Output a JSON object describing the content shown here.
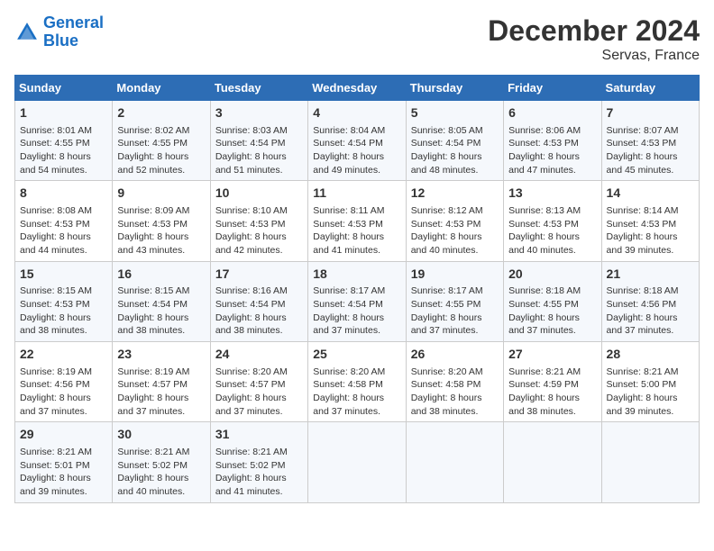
{
  "logo": {
    "line1": "General",
    "line2": "Blue"
  },
  "title": "December 2024",
  "subtitle": "Servas, France",
  "days_of_week": [
    "Sunday",
    "Monday",
    "Tuesday",
    "Wednesday",
    "Thursday",
    "Friday",
    "Saturday"
  ],
  "weeks": [
    [
      {
        "day": "1",
        "sunrise": "Sunrise: 8:01 AM",
        "sunset": "Sunset: 4:55 PM",
        "daylight": "Daylight: 8 hours and 54 minutes."
      },
      {
        "day": "2",
        "sunrise": "Sunrise: 8:02 AM",
        "sunset": "Sunset: 4:55 PM",
        "daylight": "Daylight: 8 hours and 52 minutes."
      },
      {
        "day": "3",
        "sunrise": "Sunrise: 8:03 AM",
        "sunset": "Sunset: 4:54 PM",
        "daylight": "Daylight: 8 hours and 51 minutes."
      },
      {
        "day": "4",
        "sunrise": "Sunrise: 8:04 AM",
        "sunset": "Sunset: 4:54 PM",
        "daylight": "Daylight: 8 hours and 49 minutes."
      },
      {
        "day": "5",
        "sunrise": "Sunrise: 8:05 AM",
        "sunset": "Sunset: 4:54 PM",
        "daylight": "Daylight: 8 hours and 48 minutes."
      },
      {
        "day": "6",
        "sunrise": "Sunrise: 8:06 AM",
        "sunset": "Sunset: 4:53 PM",
        "daylight": "Daylight: 8 hours and 47 minutes."
      },
      {
        "day": "7",
        "sunrise": "Sunrise: 8:07 AM",
        "sunset": "Sunset: 4:53 PM",
        "daylight": "Daylight: 8 hours and 45 minutes."
      }
    ],
    [
      {
        "day": "8",
        "sunrise": "Sunrise: 8:08 AM",
        "sunset": "Sunset: 4:53 PM",
        "daylight": "Daylight: 8 hours and 44 minutes."
      },
      {
        "day": "9",
        "sunrise": "Sunrise: 8:09 AM",
        "sunset": "Sunset: 4:53 PM",
        "daylight": "Daylight: 8 hours and 43 minutes."
      },
      {
        "day": "10",
        "sunrise": "Sunrise: 8:10 AM",
        "sunset": "Sunset: 4:53 PM",
        "daylight": "Daylight: 8 hours and 42 minutes."
      },
      {
        "day": "11",
        "sunrise": "Sunrise: 8:11 AM",
        "sunset": "Sunset: 4:53 PM",
        "daylight": "Daylight: 8 hours and 41 minutes."
      },
      {
        "day": "12",
        "sunrise": "Sunrise: 8:12 AM",
        "sunset": "Sunset: 4:53 PM",
        "daylight": "Daylight: 8 hours and 40 minutes."
      },
      {
        "day": "13",
        "sunrise": "Sunrise: 8:13 AM",
        "sunset": "Sunset: 4:53 PM",
        "daylight": "Daylight: 8 hours and 40 minutes."
      },
      {
        "day": "14",
        "sunrise": "Sunrise: 8:14 AM",
        "sunset": "Sunset: 4:53 PM",
        "daylight": "Daylight: 8 hours and 39 minutes."
      }
    ],
    [
      {
        "day": "15",
        "sunrise": "Sunrise: 8:15 AM",
        "sunset": "Sunset: 4:53 PM",
        "daylight": "Daylight: 8 hours and 38 minutes."
      },
      {
        "day": "16",
        "sunrise": "Sunrise: 8:15 AM",
        "sunset": "Sunset: 4:54 PM",
        "daylight": "Daylight: 8 hours and 38 minutes."
      },
      {
        "day": "17",
        "sunrise": "Sunrise: 8:16 AM",
        "sunset": "Sunset: 4:54 PM",
        "daylight": "Daylight: 8 hours and 38 minutes."
      },
      {
        "day": "18",
        "sunrise": "Sunrise: 8:17 AM",
        "sunset": "Sunset: 4:54 PM",
        "daylight": "Daylight: 8 hours and 37 minutes."
      },
      {
        "day": "19",
        "sunrise": "Sunrise: 8:17 AM",
        "sunset": "Sunset: 4:55 PM",
        "daylight": "Daylight: 8 hours and 37 minutes."
      },
      {
        "day": "20",
        "sunrise": "Sunrise: 8:18 AM",
        "sunset": "Sunset: 4:55 PM",
        "daylight": "Daylight: 8 hours and 37 minutes."
      },
      {
        "day": "21",
        "sunrise": "Sunrise: 8:18 AM",
        "sunset": "Sunset: 4:56 PM",
        "daylight": "Daylight: 8 hours and 37 minutes."
      }
    ],
    [
      {
        "day": "22",
        "sunrise": "Sunrise: 8:19 AM",
        "sunset": "Sunset: 4:56 PM",
        "daylight": "Daylight: 8 hours and 37 minutes."
      },
      {
        "day": "23",
        "sunrise": "Sunrise: 8:19 AM",
        "sunset": "Sunset: 4:57 PM",
        "daylight": "Daylight: 8 hours and 37 minutes."
      },
      {
        "day": "24",
        "sunrise": "Sunrise: 8:20 AM",
        "sunset": "Sunset: 4:57 PM",
        "daylight": "Daylight: 8 hours and 37 minutes."
      },
      {
        "day": "25",
        "sunrise": "Sunrise: 8:20 AM",
        "sunset": "Sunset: 4:58 PM",
        "daylight": "Daylight: 8 hours and 37 minutes."
      },
      {
        "day": "26",
        "sunrise": "Sunrise: 8:20 AM",
        "sunset": "Sunset: 4:58 PM",
        "daylight": "Daylight: 8 hours and 38 minutes."
      },
      {
        "day": "27",
        "sunrise": "Sunrise: 8:21 AM",
        "sunset": "Sunset: 4:59 PM",
        "daylight": "Daylight: 8 hours and 38 minutes."
      },
      {
        "day": "28",
        "sunrise": "Sunrise: 8:21 AM",
        "sunset": "Sunset: 5:00 PM",
        "daylight": "Daylight: 8 hours and 39 minutes."
      }
    ],
    [
      {
        "day": "29",
        "sunrise": "Sunrise: 8:21 AM",
        "sunset": "Sunset: 5:01 PM",
        "daylight": "Daylight: 8 hours and 39 minutes."
      },
      {
        "day": "30",
        "sunrise": "Sunrise: 8:21 AM",
        "sunset": "Sunset: 5:02 PM",
        "daylight": "Daylight: 8 hours and 40 minutes."
      },
      {
        "day": "31",
        "sunrise": "Sunrise: 8:21 AM",
        "sunset": "Sunset: 5:02 PM",
        "daylight": "Daylight: 8 hours and 41 minutes."
      },
      null,
      null,
      null,
      null
    ]
  ]
}
